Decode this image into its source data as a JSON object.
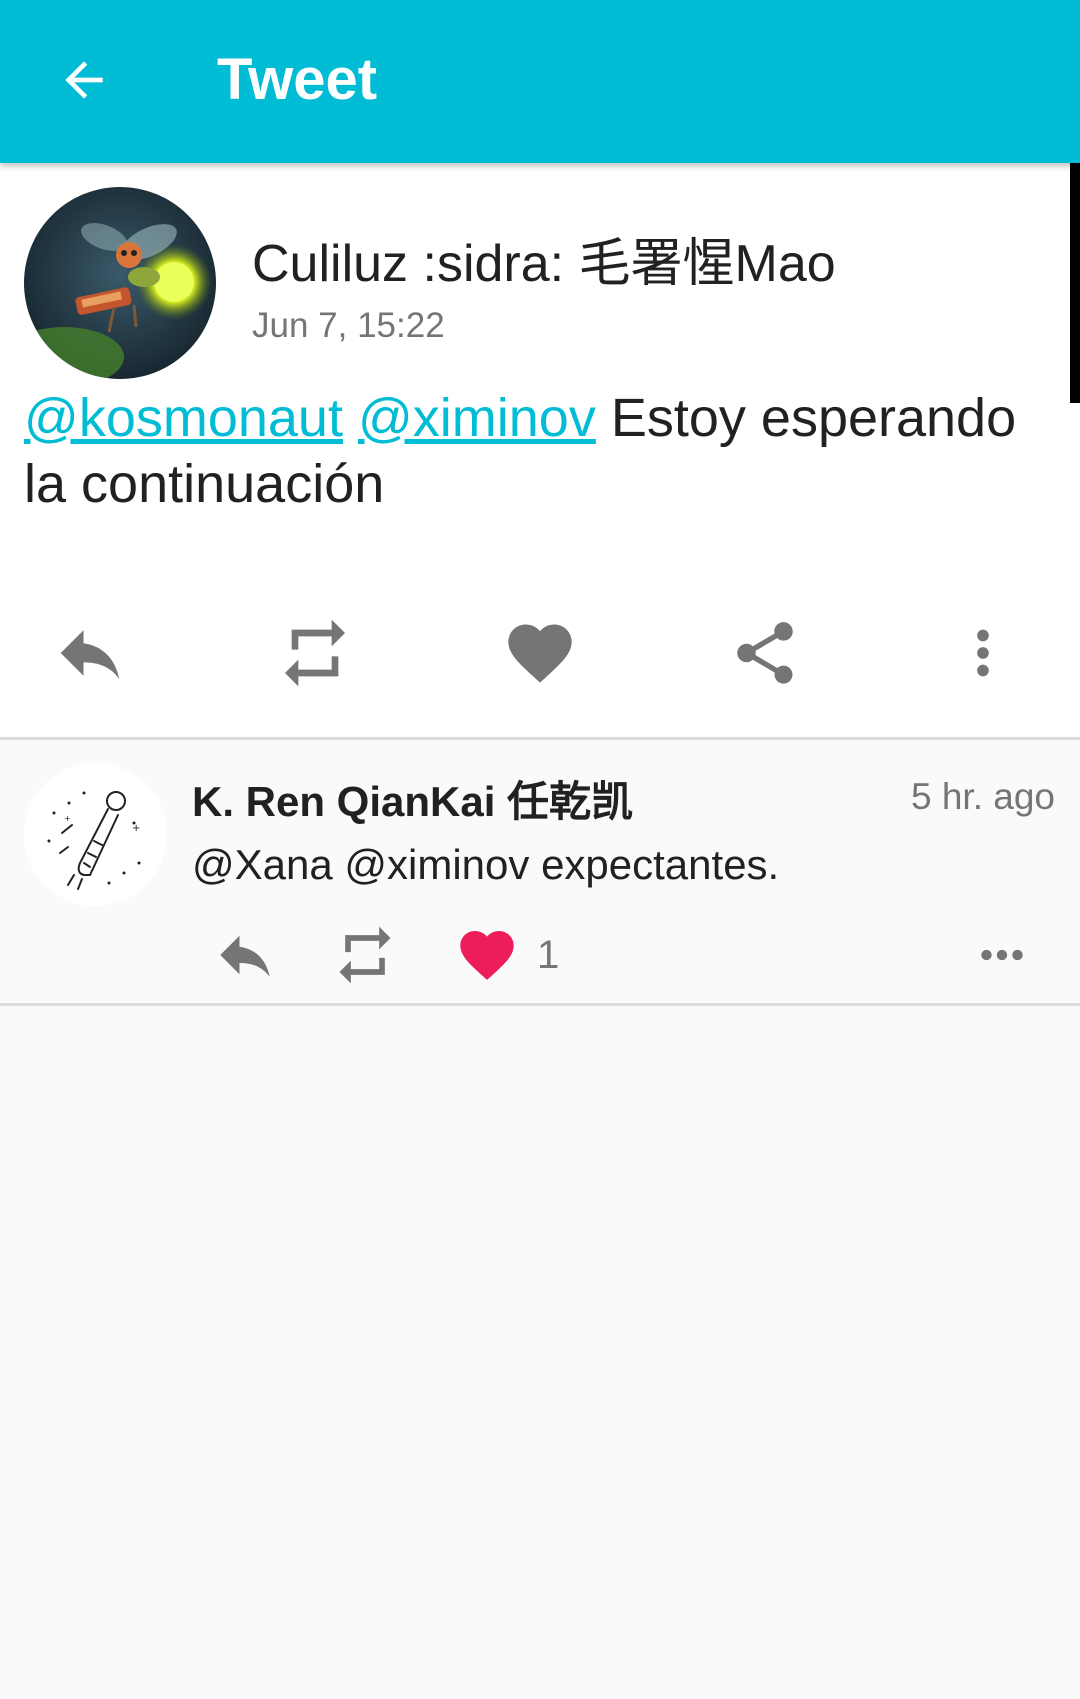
{
  "appbar": {
    "title": "Tweet",
    "back_icon": "arrow-left-icon",
    "color": "#00bcd4"
  },
  "tweet": {
    "author_name": "Culiluz :sidra: 毛署惺Mao",
    "date": "Jun 7, 15:22",
    "mention_1": "@kosmonaut",
    "mention_2": "@ximinov",
    "text_part_1": "Estoy esperando",
    "text_part_2": "la continuación",
    "actions": [
      "reply-icon",
      "retweet-icon",
      "heart-icon",
      "share-icon",
      "more-vertical-icon"
    ]
  },
  "reply": {
    "author_name": "K. Ren QianKai 任乾凯",
    "time": "5 hr. ago",
    "text": "@Xana @ximinov expectantes.",
    "like_count": "1",
    "like_color": "#ed1c5b",
    "actions": [
      "reply-icon",
      "retweet-icon",
      "heart-icon",
      "more-horizontal-icon"
    ]
  },
  "colors": {
    "accent": "#00bcd4",
    "icon_gray": "#757575",
    "like_pink": "#ed1c5b"
  }
}
